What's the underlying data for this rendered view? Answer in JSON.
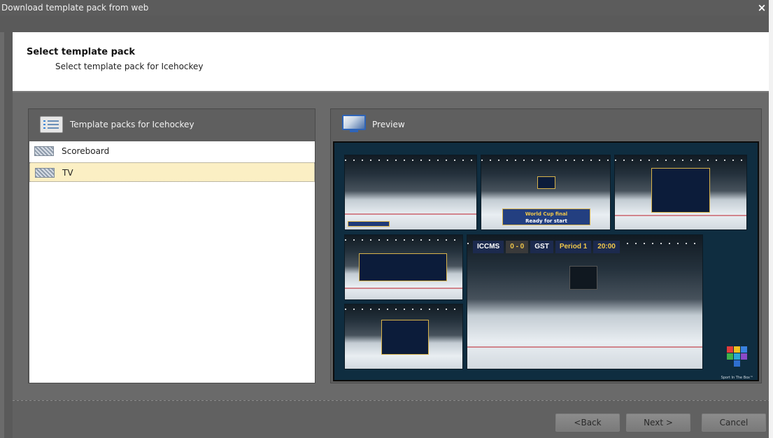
{
  "window": {
    "title": "Download template pack from web",
    "close_glyph": "×"
  },
  "header": {
    "title": "Select template pack",
    "subtitle": "Select template pack for Icehockey"
  },
  "list_panel": {
    "title": "Template packs for Icehockey",
    "icon": "list-icon",
    "items": [
      {
        "label": "Scoreboard",
        "selected": false,
        "icon": "template-icon"
      },
      {
        "label": "TV",
        "selected": true,
        "icon": "template-icon"
      }
    ]
  },
  "preview_panel": {
    "title": "Preview",
    "icon": "monitor-icon",
    "scorebar": {
      "team1": "ICCMS",
      "score": "0 - 0",
      "team2": "GST",
      "period": "Period 1",
      "clock": "20:00"
    },
    "banner_line1": "World Cup final",
    "banner_line2": "Ready for start",
    "logo_text": "Sport In The Box™"
  },
  "buttons": {
    "back": "<Back",
    "next": "Next >",
    "cancel": "Cancel"
  },
  "colors": {
    "selection_bg": "#fbefc4",
    "preview_bg": "#0f2d40",
    "accent_blue": "#2e64b8"
  }
}
